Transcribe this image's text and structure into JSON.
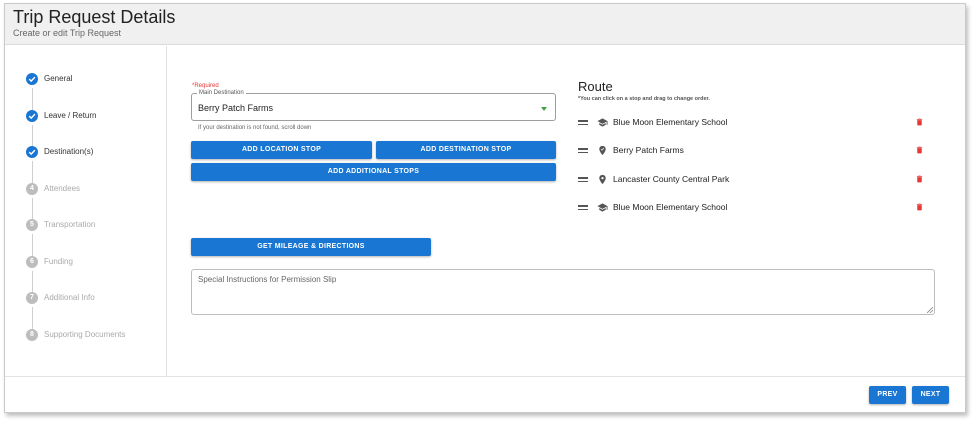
{
  "header": {
    "title": "Trip Request Details",
    "subtitle": "Create or edit Trip Request"
  },
  "stepper": {
    "steps": [
      {
        "label": "General",
        "number": "1",
        "status": "done"
      },
      {
        "label": "Leave / Return",
        "number": "2",
        "status": "done"
      },
      {
        "label": "Destination(s)",
        "number": "3",
        "status": "done"
      },
      {
        "label": "Attendees",
        "number": "4",
        "status": "inactive"
      },
      {
        "label": "Transportation",
        "number": "5",
        "status": "inactive"
      },
      {
        "label": "Funding",
        "number": "6",
        "status": "inactive"
      },
      {
        "label": "Additional Info",
        "number": "7",
        "status": "inactive"
      },
      {
        "label": "Supporting Documents",
        "number": "8",
        "status": "inactive"
      }
    ]
  },
  "destination": {
    "required_label": "*Required",
    "field_label": "Main Destination",
    "value": "Berry Patch Farms",
    "helper_text": "If your destination is not found, scroll down"
  },
  "buttons": {
    "add_location_stop": "ADD LOCATION STOP",
    "add_destination_stop": "ADD DESTINATION STOP",
    "add_additional_stops": "ADD ADDITIONAL STOPS",
    "get_mileage": "GET MILEAGE & DIRECTIONS",
    "prev": "PREV",
    "next": "NEXT"
  },
  "permission_slip": {
    "placeholder": "Special Instructions for Permission Slip"
  },
  "route": {
    "title": "Route",
    "hint": "*You can click on a stop and drag to change order.",
    "stops": [
      {
        "label": "Blue Moon Elementary School",
        "icon": "school-icon"
      },
      {
        "label": "Berry Patch Farms",
        "icon": "place-marker-icon"
      },
      {
        "label": "Lancaster County Central Park",
        "icon": "location-pin-icon"
      },
      {
        "label": "Blue Moon Elementary School",
        "icon": "school-icon"
      }
    ]
  },
  "colors": {
    "primary": "#1976d2",
    "delete": "#e53935",
    "inactive_step": "#bdbdbd"
  }
}
